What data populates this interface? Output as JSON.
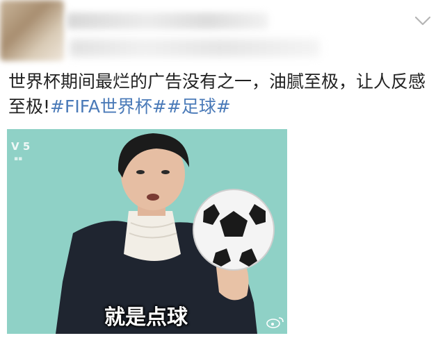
{
  "post": {
    "text_main": "世界杯期间最烂的广告没有之一，油腻至极，让人反感至极!",
    "hashtags": [
      "#FIFA世界杯#",
      "#足球#"
    ]
  },
  "media": {
    "channel_logo": "V 5",
    "subtitle": "就是点球"
  },
  "colors": {
    "hashtag": "#4a7ab8",
    "media_background": "#8fd1c6"
  },
  "icons": [
    "chevron-down-icon",
    "weibo-watermark-icon"
  ]
}
